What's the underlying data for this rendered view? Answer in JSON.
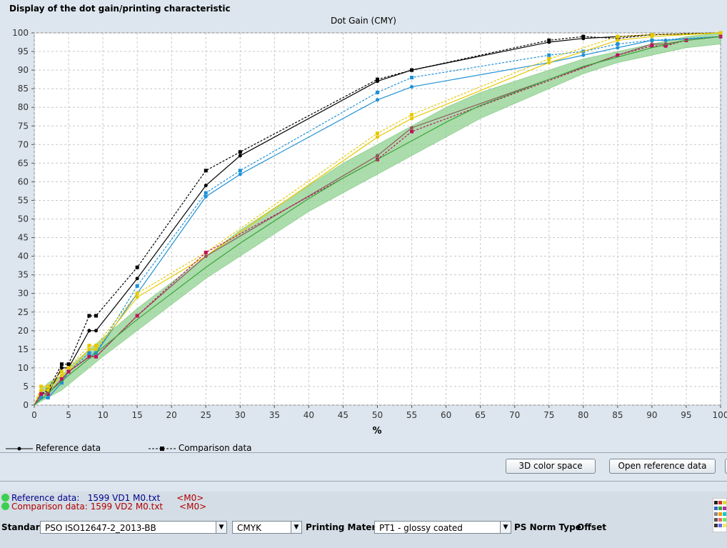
{
  "panel": {
    "title": "Display of the dot gain/printing characteristic"
  },
  "chart_data": {
    "type": "line",
    "title": "Dot Gain (CMY)",
    "xlabel": "%",
    "ylabel": "",
    "xlim": [
      0,
      100
    ],
    "ylim": [
      0,
      100
    ],
    "x_ticks": [
      0,
      5,
      10,
      15,
      20,
      25,
      30,
      35,
      40,
      45,
      50,
      55,
      60,
      65,
      70,
      75,
      80,
      85,
      90,
      95,
      100
    ],
    "y_ticks": [
      0,
      5,
      10,
      15,
      20,
      25,
      30,
      35,
      40,
      45,
      50,
      55,
      60,
      65,
      70,
      75,
      80,
      85,
      90,
      95,
      100
    ],
    "grid": true,
    "tolerance_band": {
      "color": "#8fd08f",
      "x": [
        0,
        1,
        2,
        3,
        4,
        5,
        8,
        10,
        15,
        20,
        25,
        30,
        35,
        40,
        45,
        50,
        55,
        60,
        65,
        70,
        75,
        80,
        85,
        90,
        95,
        100
      ],
      "lower": [
        0,
        1,
        2,
        3,
        4,
        5.5,
        10,
        13,
        20,
        27,
        34,
        40,
        46,
        52,
        57,
        62,
        67,
        72,
        77,
        81,
        85,
        89,
        92,
        94,
        96,
        97
      ],
      "upper": [
        0,
        4,
        6,
        7,
        8,
        10,
        15,
        18,
        26,
        33,
        40,
        47,
        53,
        59,
        65,
        70,
        75,
        80,
        84,
        87,
        90,
        93,
        95,
        97,
        99,
        100
      ]
    },
    "series": [
      {
        "name": "black-ref",
        "color": "#000000",
        "style": "solid",
        "marker": "circle",
        "x": [
          0,
          1,
          2,
          4,
          5,
          8,
          9,
          15,
          25,
          30,
          50,
          55,
          75,
          80,
          90,
          100
        ],
        "y": [
          0,
          3,
          3,
          10,
          10,
          20,
          20,
          34,
          59,
          67,
          87,
          90,
          97.5,
          98.5,
          99.5,
          100
        ]
      },
      {
        "name": "black-cmp",
        "color": "#000000",
        "style": "dashed",
        "marker": "square",
        "x": [
          0,
          1,
          2,
          4,
          5,
          8,
          9,
          15,
          25,
          30,
          50,
          55,
          75,
          80,
          85,
          90,
          100
        ],
        "y": [
          0,
          3,
          4,
          11,
          11,
          24,
          24,
          37,
          63,
          68,
          87.5,
          90,
          98,
          99,
          98.5,
          99.5,
          100
        ]
      },
      {
        "name": "cyan-ref",
        "color": "#1e90d6",
        "style": "solid",
        "marker": "circle",
        "x": [
          0,
          1,
          2,
          4,
          5,
          8,
          9,
          15,
          25,
          30,
          50,
          55,
          75,
          80,
          85,
          90,
          92,
          100
        ],
        "y": [
          0,
          2,
          2,
          6,
          9,
          13,
          14,
          30,
          56,
          62,
          82,
          85.5,
          92,
          94,
          96,
          98,
          98,
          99
        ]
      },
      {
        "name": "cyan-cmp",
        "color": "#1e90d6",
        "style": "dashed",
        "marker": "square",
        "x": [
          0,
          1,
          2,
          4,
          5,
          8,
          9,
          15,
          25,
          30,
          50,
          55,
          75,
          80,
          85,
          90,
          100
        ],
        "y": [
          0,
          2,
          2,
          6,
          9,
          14,
          14,
          32,
          57,
          63,
          84,
          88,
          94,
          95,
          97,
          98,
          99
        ]
      },
      {
        "name": "yellow-ref",
        "color": "#e8c800",
        "style": "solid",
        "marker": "circle",
        "x": [
          0,
          1,
          2,
          4,
          5,
          8,
          9,
          15,
          25,
          50,
          55,
          75,
          85,
          90,
          100
        ],
        "y": [
          0,
          4,
          4,
          8,
          9,
          15,
          15,
          29,
          40,
          72,
          77,
          92,
          98,
          99,
          100
        ]
      },
      {
        "name": "yellow-cmp",
        "color": "#e8c800",
        "style": "dashed",
        "marker": "square",
        "x": [
          0,
          1,
          2,
          4,
          5,
          8,
          9,
          15,
          25,
          50,
          55,
          75,
          85,
          90,
          100
        ],
        "y": [
          0,
          5,
          5,
          9,
          10,
          16,
          16,
          30,
          41,
          73,
          78,
          93,
          99,
          99.5,
          100
        ]
      },
      {
        "name": "magenta-ref",
        "color": "#8b5a5a",
        "style": "solid",
        "marker": "circle",
        "x": [
          0,
          1,
          2,
          4,
          5,
          8,
          9,
          15,
          25,
          50,
          55,
          85,
          90,
          92,
          95,
          100
        ],
        "y": [
          0,
          3,
          3,
          7,
          9,
          13,
          13,
          24,
          40,
          67,
          74.5,
          94,
          97,
          97,
          98,
          99
        ]
      },
      {
        "name": "magenta-cmp",
        "color": "#c01060",
        "style": "dashed",
        "marker": "square",
        "x": [
          0,
          1,
          2,
          4,
          5,
          8,
          9,
          15,
          25,
          50,
          55,
          85,
          90,
          92,
          95,
          100
        ],
        "y": [
          0,
          3,
          3,
          7,
          9,
          13,
          13,
          24,
          41,
          66,
          73.5,
          94,
          96.5,
          96.5,
          98,
          99
        ]
      },
      {
        "name": "green-center",
        "color": "#3aa53a",
        "style": "solid",
        "marker": "none",
        "x": [
          0,
          5,
          10,
          15,
          20,
          25,
          30,
          35,
          40,
          45,
          50,
          55,
          60,
          65,
          70,
          75,
          80,
          85,
          90,
          95,
          100
        ],
        "y": [
          0,
          8,
          15.5,
          23,
          30,
          37,
          43.5,
          49.5,
          55.5,
          61,
          66,
          71,
          76,
          80.5,
          84,
          87.5,
          91,
          93.5,
          96,
          98,
          99
        ]
      }
    ],
    "legend": {
      "position": "bottom-left",
      "entries": [
        {
          "label": "Reference data",
          "style": "solid",
          "marker": "circle"
        },
        {
          "label": "Comparison data",
          "style": "dashed",
          "marker": "square"
        }
      ]
    }
  },
  "buttons": {
    "color_space": "3D color space",
    "open_reference": "Open reference data"
  },
  "info": {
    "reference": {
      "label": "Reference data:",
      "value": "1599  VD1  M0.txt",
      "tag": "<M0>"
    },
    "comparison": {
      "label": "Comparison data:",
      "value": "1599  VD2  M0.txt",
      "tag": "<M0>"
    }
  },
  "settings": {
    "standard_label": "Standard",
    "standard_value": "PSO ISO12647-2_2013-BB",
    "colorspace_value": "CMYK",
    "material_label": "Printing Material",
    "material_value": "PT1 - glossy coated",
    "norm_label": "PS Norm Type",
    "norm_value": "Offset"
  }
}
